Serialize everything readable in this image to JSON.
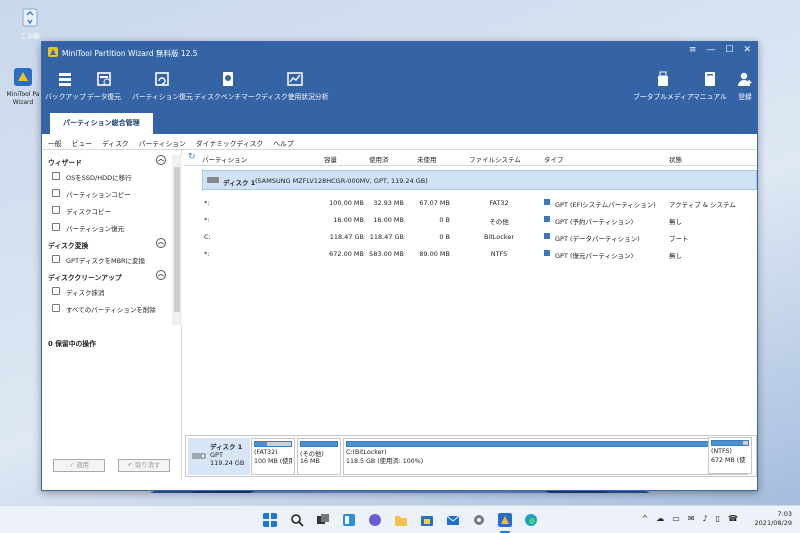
{
  "desktop": {
    "recycle_bin": "ごみ箱",
    "shortcut": "MiniTool Pa Wizard"
  },
  "window": {
    "title": "MiniTool Partition Wizard 無料版 12.5",
    "controls": [
      "≡",
      "—",
      "☐",
      "✕"
    ]
  },
  "toolbar": {
    "left": [
      {
        "label": "バックアップ",
        "icon": "backup-icon"
      },
      {
        "label": "データ復元",
        "icon": "data-recovery-icon"
      },
      {
        "label": "パーティション復元",
        "icon": "partition-recovery-icon"
      },
      {
        "label": "ディスクベンチマーク",
        "icon": "disk-benchmark-icon"
      },
      {
        "label": "ディスク使用状況分析",
        "icon": "space-analyzer-icon"
      }
    ],
    "right": [
      {
        "label": "ブータブルメディア",
        "icon": "bootable-media-icon"
      },
      {
        "label": "マニュアル",
        "icon": "manual-icon"
      },
      {
        "label": "登録",
        "icon": "register-icon"
      }
    ]
  },
  "tab": "パーティション総合管理",
  "menu": [
    "一般",
    "ビュー",
    "ディスク",
    "パーティション",
    "ダイナミックディスク",
    "ヘルプ"
  ],
  "sidebar": {
    "wizard": {
      "title": "ウィザード",
      "items": [
        "OSをSSD/HDDに移行",
        "パーティションコピー",
        "ディスクコピー",
        "パーティション復元"
      ]
    },
    "convert": {
      "title": "ディスク変換",
      "items": [
        "GPTディスクをMBRに変換"
      ]
    },
    "cleanup": {
      "title": "ディスククリーンアップ",
      "items": [
        "ディスク抹消",
        "すべてのパーティションを削除"
      ]
    },
    "pending": "0 保留中の操作",
    "apply": "✓ 適用",
    "undo": "↶ 取り消す"
  },
  "table": {
    "headers": [
      "パーティション",
      "容量",
      "使用済",
      "未使用",
      "ファイルシステム",
      "タイプ",
      "状態"
    ],
    "disk_label": "ディスク 1",
    "disk_detail": "(SAMSUNG MZFLV128HCGR-000MV, GPT, 119.24 GB)",
    "rows": [
      {
        "name": "*:",
        "capacity": "100.00 MB",
        "used": "32.93 MB",
        "unused": "67.07 MB",
        "fs": "FAT32",
        "type": "GPT (EFIシステムパーティション)",
        "status": "アクティブ & システム"
      },
      {
        "name": "*:",
        "capacity": "16.00 MB",
        "used": "16.00 MB",
        "unused": "0 B",
        "fs": "その他",
        "type": "GPT (予約パーティション)",
        "status": "無し"
      },
      {
        "name": "C:",
        "capacity": "118.47 GB",
        "used": "118.47 GB",
        "unused": "0 B",
        "fs": "BitLocker",
        "type": "GPT (データパーティション)",
        "status": "ブート"
      },
      {
        "name": "*:",
        "capacity": "672.00 MB",
        "used": "583.00 MB",
        "unused": "89.00 MB",
        "fs": "NTFS",
        "type": "GPT (復元パーティション)",
        "status": "無し"
      }
    ]
  },
  "diskmap": {
    "name": "ディスク 1",
    "style": "GPT",
    "size": "119.24 GB",
    "segments": [
      {
        "l1": "(FAT32)",
        "l2": "100 MB (使用",
        "used_pct": 33
      },
      {
        "l1": "(その他)",
        "l2": "16 MB",
        "used_pct": 100
      },
      {
        "l1": "C:(BitLocker)",
        "l2": "118.5 GB (使用済: 100%)",
        "used_pct": 100
      },
      {
        "l1": "(NTFS)",
        "l2": "672 MB (使",
        "used_pct": 87
      }
    ]
  },
  "taskbar": {
    "time": "7:03",
    "date": "2021/08/29",
    "tray": [
      "^",
      "☁",
      "▭",
      "✉",
      "♪",
      "▯",
      "☎"
    ]
  },
  "colors": {
    "titlebar": "#3564a6",
    "accent": "#4e90d1",
    "selection": "#cfe2f6"
  }
}
